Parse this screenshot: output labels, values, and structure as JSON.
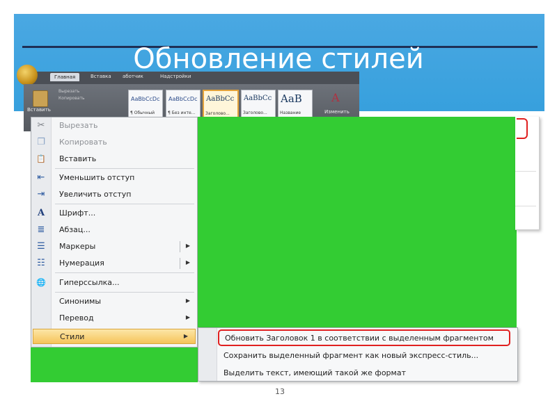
{
  "slide": {
    "title": "Обновление стилей",
    "page_number": "13"
  },
  "ribbon": {
    "tabs": [
      "Главная",
      "Вставка",
      "аботчик",
      "Надстройки"
    ],
    "paste_label": "Вставить",
    "clipboard_items": [
      "Вырезать",
      "Копировать"
    ],
    "styles": [
      {
        "sample": "AaBbCcDc",
        "name": "¶ Обычный"
      },
      {
        "sample": "AaBbCcDc",
        "name": "¶ Без инте..."
      },
      {
        "sample": "AaBbCc",
        "name": "Заголово..."
      },
      {
        "sample": "AaBbCc",
        "name": "Заголово..."
      },
      {
        "sample": "AaB",
        "name": "Название"
      }
    ],
    "change_styles_label": "Изменить"
  },
  "context_menu": {
    "items": [
      {
        "label": "Вырезать",
        "icon": "scissors-icon",
        "glyph": "✂",
        "disabled": true
      },
      {
        "label": "Копировать",
        "icon": "copy-icon",
        "glyph": "❐",
        "disabled": true
      },
      {
        "label": "Вставить",
        "icon": "paste-icon",
        "glyph": "📋",
        "disabled": false
      },
      {
        "label": "Уменьшить отступ",
        "icon": "decrease-indent-icon",
        "glyph": "⇤",
        "disabled": false
      },
      {
        "label": "Увеличить отступ",
        "icon": "increase-indent-icon",
        "glyph": "⇥",
        "disabled": false
      },
      {
        "label": "Шрифт...",
        "icon": "font-icon",
        "glyph": "A",
        "disabled": false
      },
      {
        "label": "Абзац...",
        "icon": "paragraph-icon",
        "glyph": "≣",
        "disabled": false
      },
      {
        "label": "Маркеры",
        "icon": "bullets-icon",
        "glyph": "☰",
        "disabled": false,
        "submenu": true,
        "split": true
      },
      {
        "label": "Нумерация",
        "icon": "numbering-icon",
        "glyph": "☷",
        "disabled": false,
        "submenu": true,
        "split": true
      },
      {
        "label": "Гиперссылка...",
        "icon": "hyperlink-icon",
        "glyph": "🌐",
        "disabled": false
      },
      {
        "label": "Синонимы",
        "icon": "",
        "glyph": "",
        "disabled": false,
        "submenu": true
      },
      {
        "label": "Перевод",
        "icon": "",
        "glyph": "",
        "disabled": false,
        "submenu": true
      },
      {
        "label": "Стили",
        "icon": "",
        "glyph": "",
        "disabled": false,
        "submenu": true,
        "active": true
      }
    ]
  },
  "styles_submenu": {
    "items": [
      {
        "label": "Обновить Заголовок 1 в соответствии с выделенным фрагментом",
        "highlight": true
      },
      {
        "label": "Сохранить выделенный фрагмент как новый экспресс-стиль..."
      },
      {
        "label": "Выделить текст, имеющий такой же формат"
      }
    ]
  },
  "colors": {
    "banner": "#37a0dd",
    "green_fill": "#33cc33",
    "highlight_border": "#e02020",
    "menu_active": "#f6c45a"
  }
}
